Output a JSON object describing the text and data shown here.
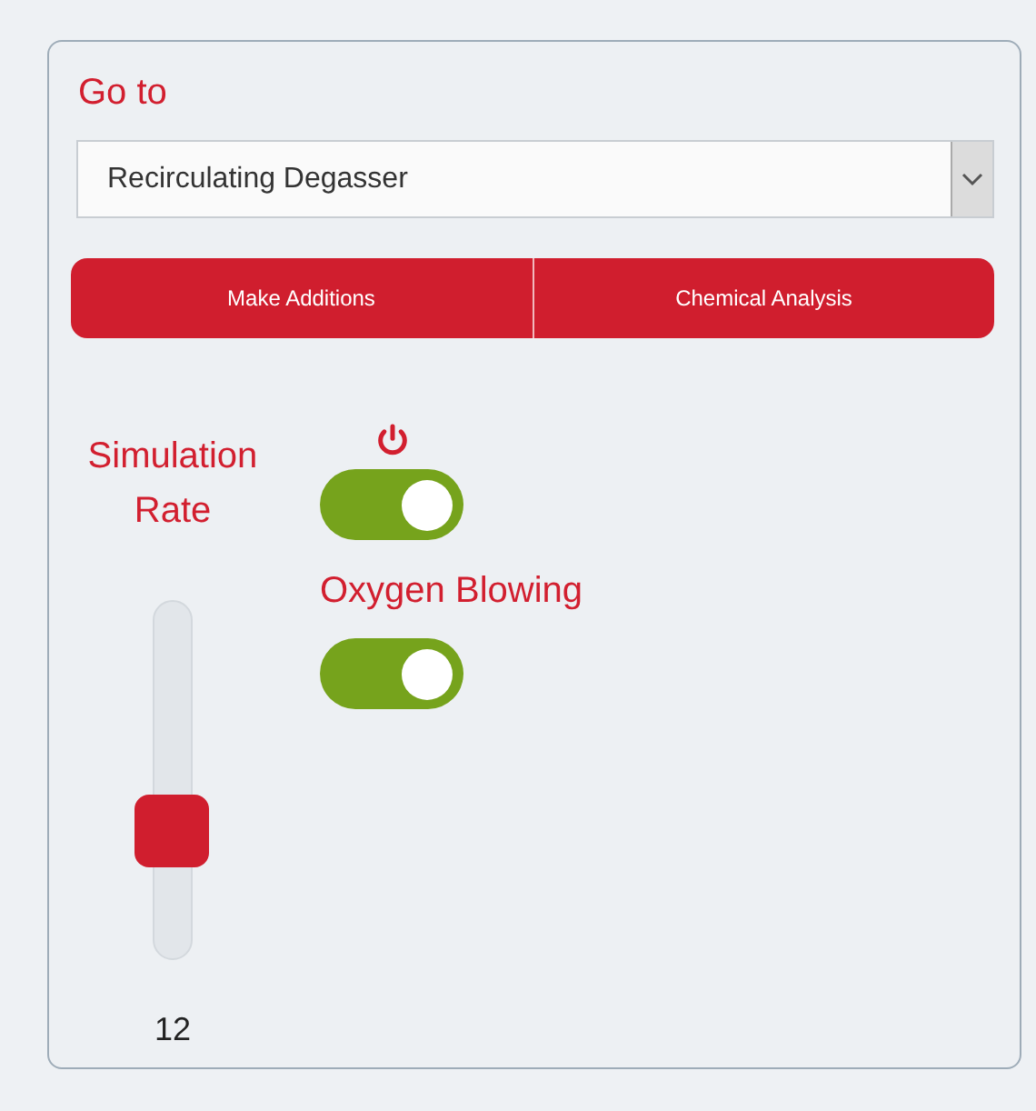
{
  "goto": {
    "title": "Go to",
    "value": "Recirculating Degasser"
  },
  "actions": [
    "Make Additions",
    "Chemical Analysis"
  ],
  "simulation_rate": {
    "label": "Simulation Rate",
    "level": 0.32,
    "reading": "12"
  },
  "switches": [
    {
      "kind": "power",
      "on": true
    },
    {
      "kind": "labeled",
      "label": "Oxygen Blowing",
      "on": true
    }
  ]
}
